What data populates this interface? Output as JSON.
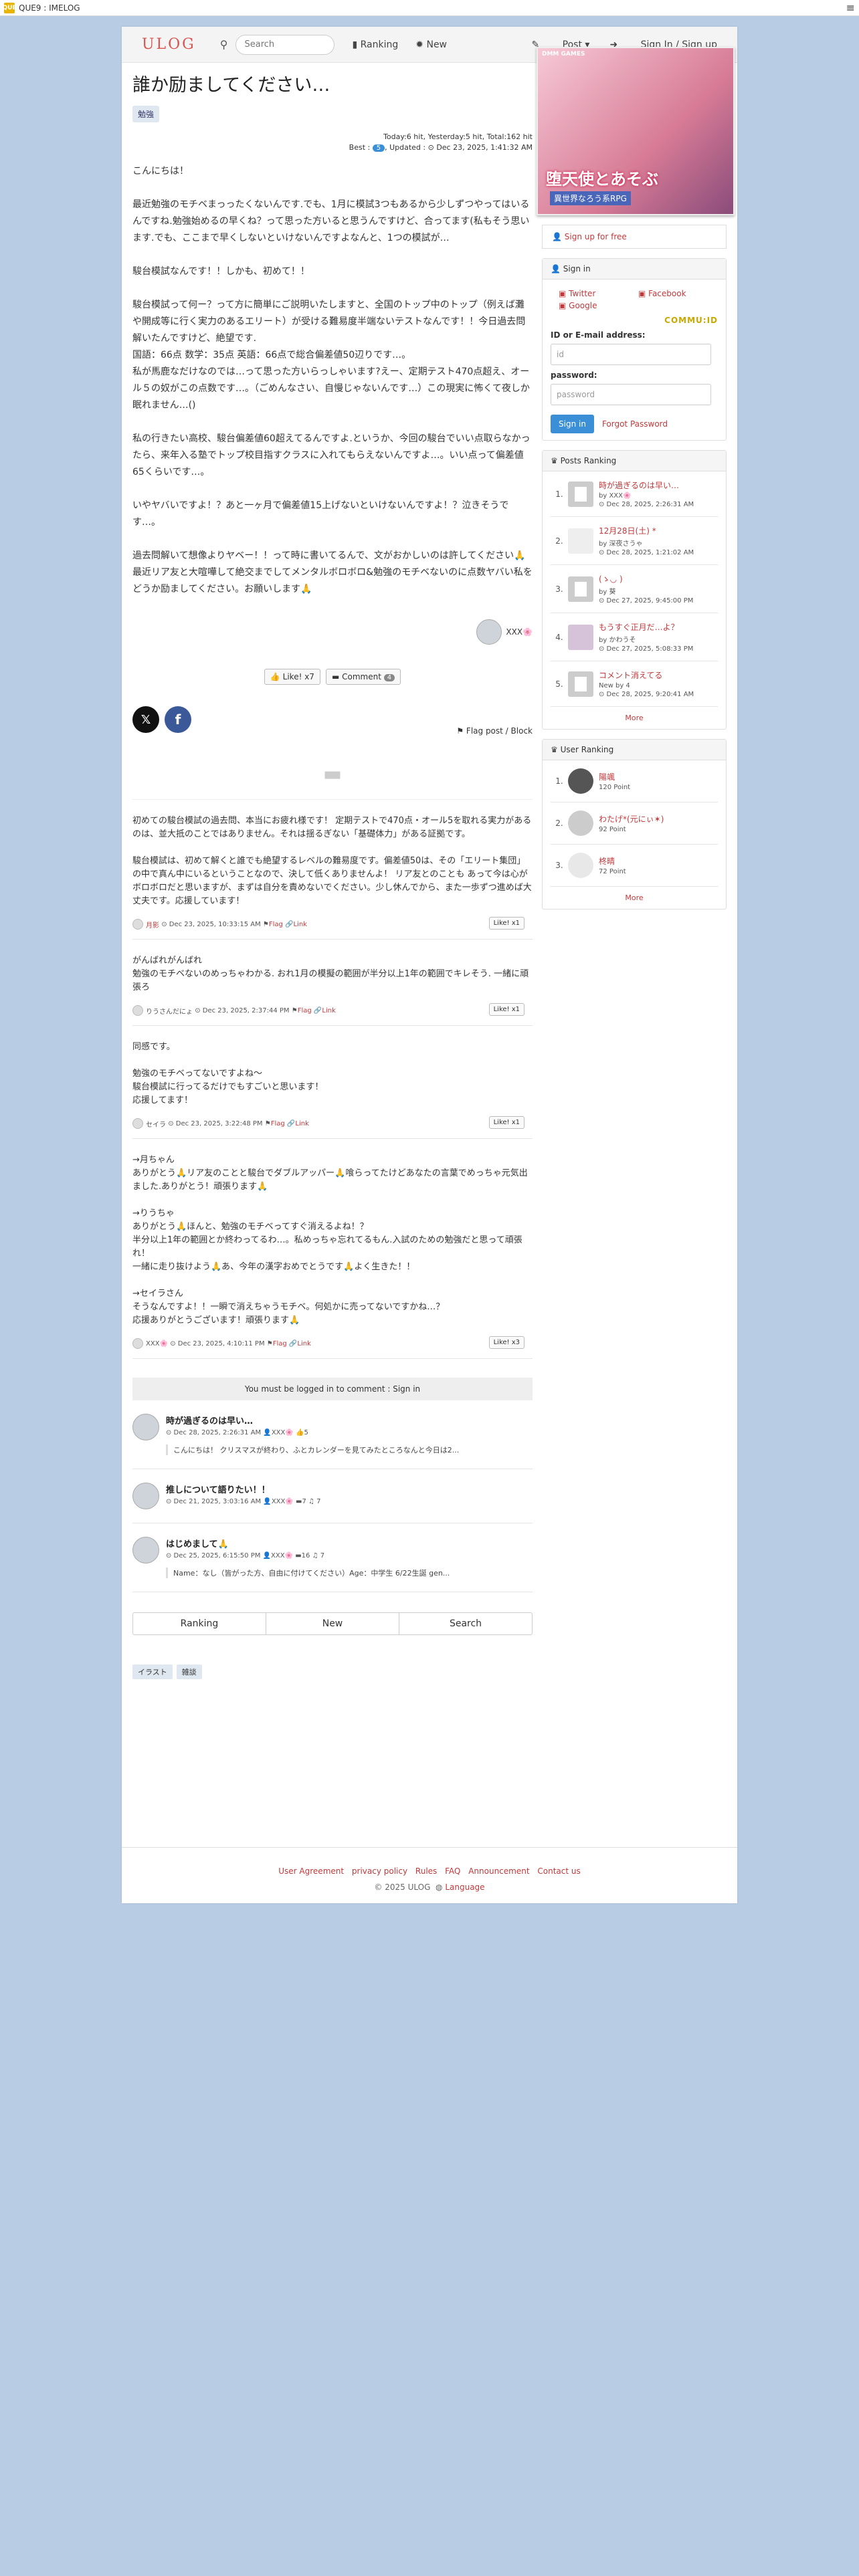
{
  "window": {
    "app_badge": "QUE",
    "title": "QUE9 : IMELOG",
    "menu_icon": "menu-icon"
  },
  "nav": {
    "brand": "ULOG",
    "search_placeholder": "Search",
    "ranking": "Ranking",
    "new": "New",
    "post": "Post",
    "signin": "Sign In / Sign up"
  },
  "post": {
    "title": "誰か励ましてください…",
    "tag": "勉強",
    "stats": "Today:6 hit,  Yesterday:5 hit,  Total:162 hit",
    "best_label": "Best :",
    "best_badge": "5",
    "updated": ", Updated : ⊙ Dec 23, 2025, 1:41:32 AM",
    "body": "こんにちは！\n\n最近勉強のモチベまっったくないんです.でも、1月に模試3つもあるから少しずつやってはいるんですね.勉強始めるの早くね？って思った方いると思うんですけど、合ってます(私もそう思います.でも、ここまで早くしないといけないんですよなんと、1つの模試が…\n\n駿台模試なんです！！しかも、初めて！！\n\n駿台模試って何ー？って方に簡単にご説明いたしますと、全国のトップ中のトップ（例えば灘や開成等に行く実力のあるエリート）が受ける難易度半端ないテストなんです！！今日過去問解いたんですけど、絶望です.\n国語：66点 数学：35点 英語：66点で総合偏差値50辺りです…。\n私が馬鹿なだけなのでは…って思った方いらっしゃいます?えー、定期テスト470点超え、オール５の奴がこの点数です…。（ごめんなさい、自慢じゃないんです…）この現実に怖くて夜しか眠れません…()\n\n私の行きたい高校、駿台偏差値60超えてるんですよ.というか、今回の駿台でいい点取らなかったら、来年入る塾でトップ校目指すクラスに入れてもらえないんですよ…。いい点って偏差値65くらいです…。\n\nいやヤバいですよ！？あと一ヶ月で偏差値15上げないといけないんですよ！？泣きそうです…。\n\n過去問解いて想像よりヤベー！！って時に書いてるんで、文がおかしいのは許してください🙏最近リア友と大喧嘩して絶交までしてメンタルボロボロ&勉強のモチベないのに点数ヤバい私をどうか励ましてください。お願いします🙏",
    "author": "XXX🌸",
    "like": "Like! x7",
    "comment": "Comment",
    "comment_count": "4",
    "share_x": "𝕏",
    "share_fb": "f",
    "flag": "Flag post / Block"
  },
  "comments": [
    {
      "text": "初めての駿台模試の過去問、本当にお疲れ様です！ 定期テストで470点・オール5を取れる実力があるのは、並大抵のことではありません。それは揺るぎない「基礎体力」がある証拠です。\n\n駿台模試は、初めて解くと誰でも絶望するレベルの難易度です。偏差値50は、その「エリート集団」の中で真ん中にいるということなので、決して低くありませんよ！ リア友とのことも あって今は心がボロボロだと思いますが、まずは自分を責めないでください。少し休んでから、また一歩ずつ進めば大丈夫です。応援しています！",
      "user": "月影",
      "date": "⊙ Dec 23, 2025, 10:33:15 AM",
      "flag": "Flag",
      "link": "Link",
      "like": "Like! x1"
    },
    {
      "text": "がんばれがんばれ\n勉強のモチベないのめっちゃわかる. おれ1月の模擬の範囲が半分以上1年の範囲でキレそう. 一緒に頑張ろ",
      "user": "りうさんだにょ",
      "date": "⊙ Dec 23, 2025, 2:37:44 PM",
      "flag": "Flag",
      "link": "Link",
      "like": "Like! x1"
    },
    {
      "text": "同感です。\n\n勉強のモチベってないですよね〜\n駿台模試に行ってるだけでもすごいと思います！\n応援してます！",
      "user": "セイラ",
      "date": "⊙ Dec 23, 2025, 3:22:48 PM",
      "flag": "Flag",
      "link": "Link",
      "like": "Like! x1"
    },
    {
      "text": "→月ちゃん\nありがとう🙏リア友のことと駿台でダブルアッパー🙏喰らってたけどあなたの言葉でめっちゃ元気出ました.ありがとう！頑張ります🙏\n\n→りうちゃ\nありがとう🙏ほんと、勉強のモチベってすぐ消えるよね！？\n半分以上1年の範囲とか終わってるわ…。私めっちゃ忘れてるもん.入試のための勉強だと思って頑張れ！\n一緒に走り抜けよう🙏あ、今年の漢字おめでとうです🙏よく生きた！！\n\n→セイラさん\nそうなんですよ！！一瞬で消えちゃうモチベ。何処かに売ってないですかね…？\n応援ありがとうございます！頑張ります🙏",
      "user": "XXX🌸",
      "date": "⊙ Dec 23, 2025, 4:10:11 PM",
      "flag": "Flag",
      "link": "Link",
      "like": "Like! x3"
    }
  ],
  "login_note": "You must be logged in to comment : Sign in",
  "related": [
    {
      "title": "時が過ぎるのは早い…",
      "date": "⊙ Dec 28, 2025, 2:26:31 AM",
      "user": "XXX🌸",
      "count": "5",
      "excerpt": "こんにちは！ クリスマスが終わり、ふとカレンダーを見てみたところなんと今日は2..."
    },
    {
      "title": "推しについて語りたい！！",
      "date": "⊙ Dec 21, 2025, 3:03:16 AM",
      "user": "XXX🌸",
      "count": "7 ♫ 7",
      "excerpt": ""
    },
    {
      "title": "はじめまして🙏",
      "date": "⊙ Dec 25, 2025, 6:15:50 PM",
      "user": "XXX🌸",
      "count": "16 ♫ 7",
      "excerpt": "Name：なし（皆がった方、自由に付けてください）Age：中学生 6/22生誕 gen..."
    }
  ],
  "bottom_tabs": [
    "Ranking",
    "New",
    "Search"
  ],
  "bottom_tags": [
    "イラスト",
    "雑談"
  ],
  "ad": {
    "brand": "DMM GAMES",
    "title": "堕天使とあそぶ",
    "sub": "異世界なろう系RPG"
  },
  "side": {
    "signup": "Sign up for free",
    "signin_title": "Sign in",
    "twitter": "Twitter",
    "facebook": "Facebook",
    "google": "Google",
    "commu": "COMMU:ID",
    "id_label": "ID or E-mail address:",
    "id_placeholder": "id",
    "pw_label": "password:",
    "pw_placeholder": "password",
    "signin_btn": "Sign in",
    "forgot": "Forgot Password",
    "posts_title": "Posts Ranking",
    "posts": [
      {
        "n": "1.",
        "t": "時が過ぎるのは早い…",
        "by": "by XXX🌸",
        "d": "⊙ Dec 28, 2025, 2:26:31 AM"
      },
      {
        "n": "2.",
        "t": "12月28日(土) *",
        "by": "by 深夜さうゃ",
        "d": "⊙ Dec 28, 2025, 1:21:02 AM"
      },
      {
        "n": "3.",
        "t": "(ゝ◡ )",
        "by": "by 葵",
        "d": "⊙ Dec 27, 2025, 9:45:00 PM"
      },
      {
        "n": "4.",
        "t": "もうすぐ正月だ…よ？",
        "by": "by かわうそ",
        "d": "⊙ Dec 27, 2025, 5:08:33 PM"
      },
      {
        "n": "5.",
        "t": "コメント消えてる",
        "by": "New by 4",
        "d": "⊙ Dec 28, 2025, 9:20:41 AM"
      }
    ],
    "more": "More",
    "users_title": "User Ranking",
    "users": [
      {
        "n": "1.",
        "name": "陽颯",
        "pts": "120 Point"
      },
      {
        "n": "2.",
        "name": "わたげ*(元にぃ✶)",
        "pts": "92 Point"
      },
      {
        "n": "3.",
        "name": "柊晴",
        "pts": "72 Point"
      }
    ]
  },
  "footer": {
    "links": [
      "User Agreement",
      "privacy policy",
      "Rules",
      "FAQ",
      "Announcement",
      "Contact us"
    ],
    "copy": "© 2025  ULOG",
    "lang": "Language"
  }
}
